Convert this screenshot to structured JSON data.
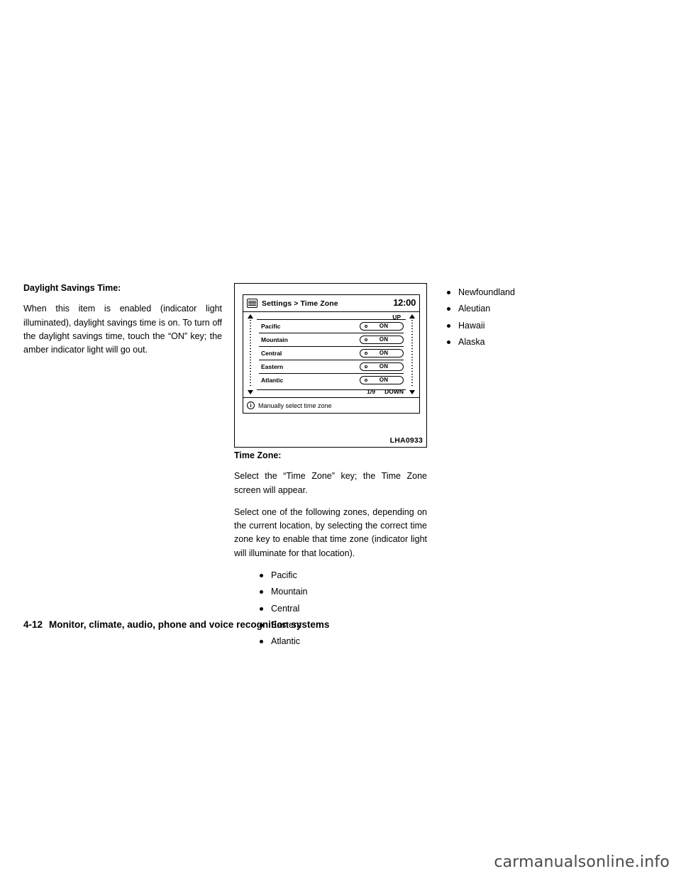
{
  "left_column": {
    "heading": "Daylight Savings Time:",
    "paragraph": "When this item is enabled (indicator light illuminated), daylight savings time is on. To turn off the daylight savings time, touch the “ON” key; the amber indicator light will go out."
  },
  "figure": {
    "caption": "LHA0933",
    "screen": {
      "title": "Settings > Time Zone",
      "clock": "12:00",
      "menu_icon": "menu-list-icon",
      "scroll_up_label": "UP",
      "scroll_down_label": "DOWN",
      "page_indicator": "1/9",
      "rows": [
        {
          "name": "Pacific",
          "key_label": "ON"
        },
        {
          "name": "Mountain",
          "key_label": "ON"
        },
        {
          "name": "Central",
          "key_label": "ON"
        },
        {
          "name": "Eastern",
          "key_label": "ON"
        },
        {
          "name": "Atlantic",
          "key_label": "ON"
        }
      ],
      "footer_icon": "info-icon",
      "footer_text": "Manually select time zone"
    }
  },
  "mid_column": {
    "heading": "Time Zone:",
    "paragraph_1": "Select the “Time Zone” key; the Time Zone screen will appear.",
    "paragraph_2": "Select one of the following zones, depending on the current location, by selecting the correct time zone key to enable that time zone (indicator light will illuminate for that location).",
    "bullets": [
      "Pacific",
      "Mountain",
      "Central",
      "Eastern",
      "Atlantic"
    ]
  },
  "right_column": {
    "bullets": [
      "Newfoundland",
      "Aleutian",
      "Hawaii",
      "Alaska"
    ]
  },
  "footer": {
    "page_number": "4-12",
    "chapter_title": "Monitor, climate, audio, phone and voice recognition systems"
  },
  "watermark": {
    "text_main": "carmanualsonline",
    "text_suffix": ".info"
  }
}
